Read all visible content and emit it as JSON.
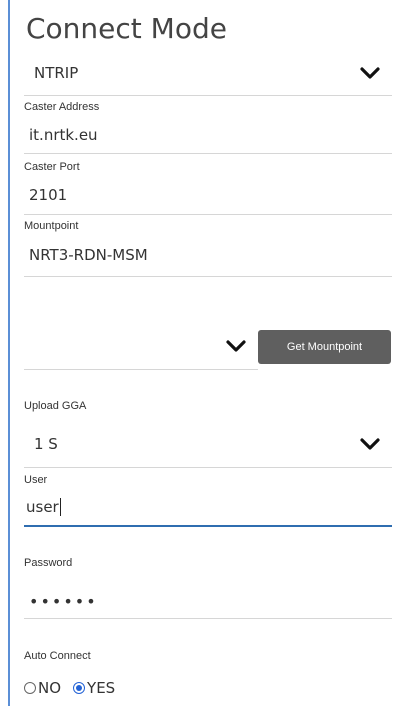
{
  "header": {
    "title": "Connect Mode"
  },
  "connect_mode": {
    "selected": "NTRIP"
  },
  "caster": {
    "address_label": "Caster Address",
    "address_value": "it.nrtk.eu",
    "port_label": "Caster Port",
    "port_value": "2101"
  },
  "mountpoint": {
    "label": "Mountpoint",
    "value": "NRT3-RDN-MSM",
    "button_label": "Get Mountpoint"
  },
  "upload_gga": {
    "label": "Upload GGA",
    "selected": "1 S"
  },
  "credentials": {
    "user_label": "User",
    "user_value": "user",
    "password_label": "Password",
    "password_value": "••••••"
  },
  "auto_connect": {
    "label": "Auto Connect",
    "option_no": "NO",
    "option_yes": "YES"
  },
  "colors": {
    "accent": "#2f6db0",
    "button": "#5f5f5f",
    "radio_selected": "#2463d6"
  },
  "icons": {
    "chevron": "chevron-down-icon"
  }
}
